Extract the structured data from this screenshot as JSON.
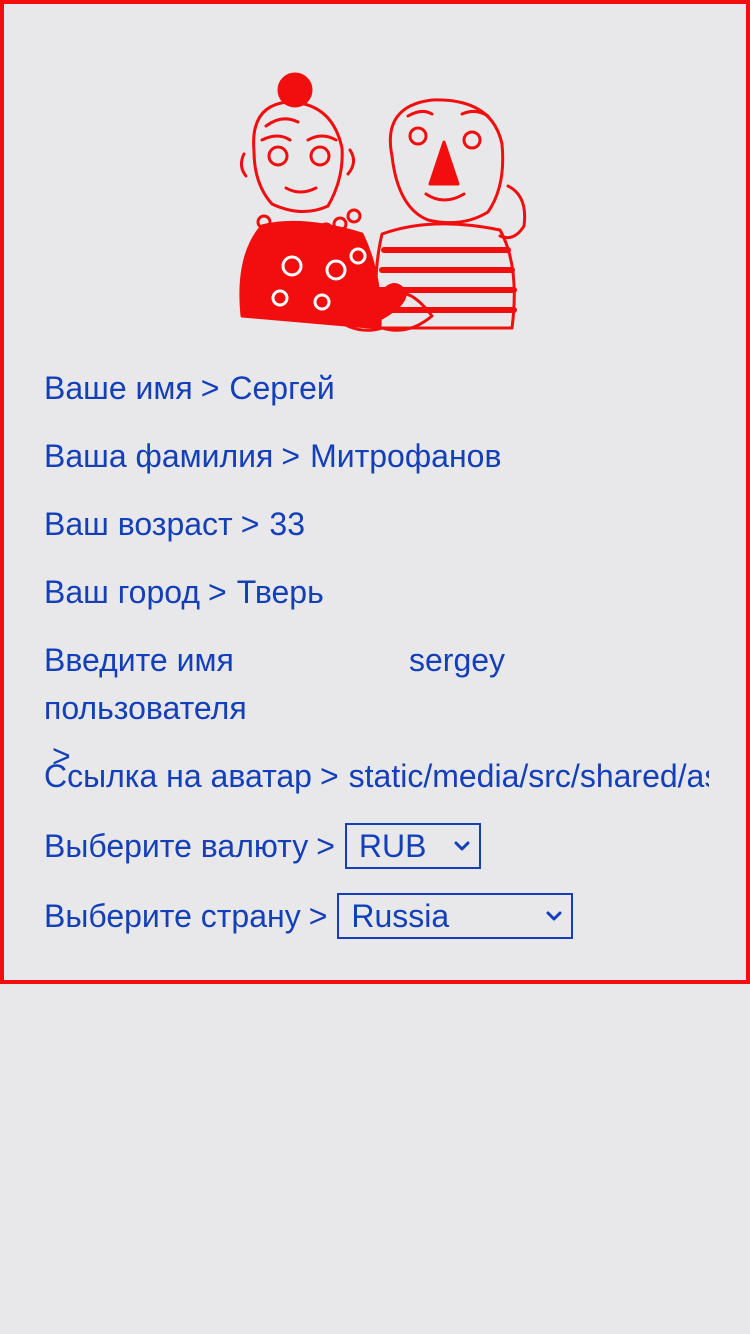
{
  "form": {
    "first_name": {
      "label": "Ваше имя",
      "separator": ">",
      "value": "Сергей"
    },
    "last_name": {
      "label": "Ваша фамилия",
      "separator": ">",
      "value": "Митрофанов"
    },
    "age": {
      "label": "Ваш возраст",
      "separator": ">",
      "value": "33"
    },
    "city": {
      "label": "Ваш город",
      "separator": ">",
      "value": "Тверь"
    },
    "username": {
      "label": "Введите имя пользователя",
      "separator": ">",
      "value": "sergey"
    },
    "avatar": {
      "label": "Ссылка на аватар",
      "separator": ">",
      "value": "static/media/src/shared/as"
    },
    "currency": {
      "label": "Выберите валюту",
      "separator": ">",
      "selected": "RUB"
    },
    "country": {
      "label": "Выберите страну",
      "separator": ">",
      "selected": "Russia"
    }
  },
  "colors": {
    "accent": "#f20e0e",
    "text": "#1340b8",
    "background": "#e8e7ea"
  },
  "icons": {
    "illustration": "couple-heart-illustration",
    "dropdown": "chevron-down-icon"
  }
}
